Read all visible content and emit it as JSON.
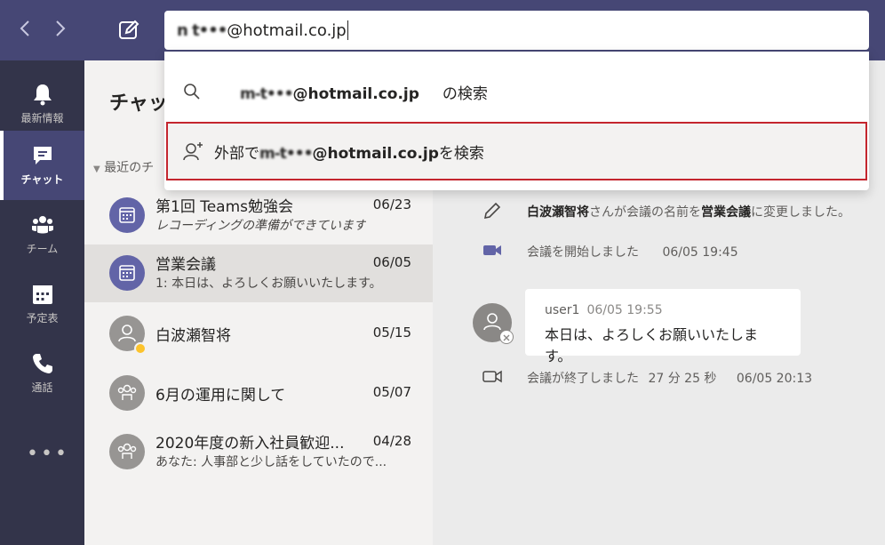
{
  "search": {
    "query_obscured": "n t•••",
    "query_domain": "@hotmail.co.jp"
  },
  "dropdown": {
    "search_email_obscured": "m-t•••",
    "search_email_domain": "@hotmail.co.jp",
    "search_suffix": "の検索",
    "external_prefix": "外部で",
    "external_email_obscured": "m-t•••",
    "external_email_domain": "@hotmail.co.jp",
    "external_suffix": "を検索"
  },
  "rail": {
    "activity": "最新情報",
    "chat": "チャット",
    "teams": "チーム",
    "calendar": "予定表",
    "calls": "通話",
    "more": "•••"
  },
  "chatlist": {
    "title": "チャット",
    "recent_label": "最近のチ",
    "items": [
      {
        "name": "第1回 Teams勉強会",
        "date": "06/23",
        "preview": "レコーディングの準備ができています"
      },
      {
        "name": "営業会議",
        "date": "06/05",
        "preview": "1: 本日は、よろしくお願いいたします。"
      },
      {
        "name": "白波瀬智将",
        "date": "05/15",
        "preview": ""
      },
      {
        "name": "6月の運用に関して",
        "date": "05/07",
        "preview": ""
      },
      {
        "name": "2020年度の新入社員歓迎...",
        "date": "04/28",
        "preview": "あなた: 人事部と少し話をしていたので..."
      }
    ]
  },
  "convo": {
    "rename_user": "白波瀬智将",
    "rename_mid": "さんが会議の名前を",
    "rename_name": "営業会議",
    "rename_end": "に変更しました。",
    "meeting_start": "会議を開始しました",
    "meeting_start_time": "06/05 19:45",
    "msg_user": "user1",
    "msg_time": "06/05 19:55",
    "msg_text": "本日は、よろしくお願いいたします。",
    "meeting_end": "会議が終了しました",
    "meeting_duration": "27 分 25 秒",
    "meeting_end_time": "06/05 20:13"
  },
  "icons": {
    "back": "chevron-left-icon",
    "forward": "chevron-right-icon",
    "compose": "compose-icon",
    "search": "search-icon",
    "add_person": "add-person-icon"
  },
  "colors": {
    "topbar": "#464775",
    "rail": "#33344a",
    "accent": "#6264a7",
    "highlight_border": "#c4262e"
  }
}
